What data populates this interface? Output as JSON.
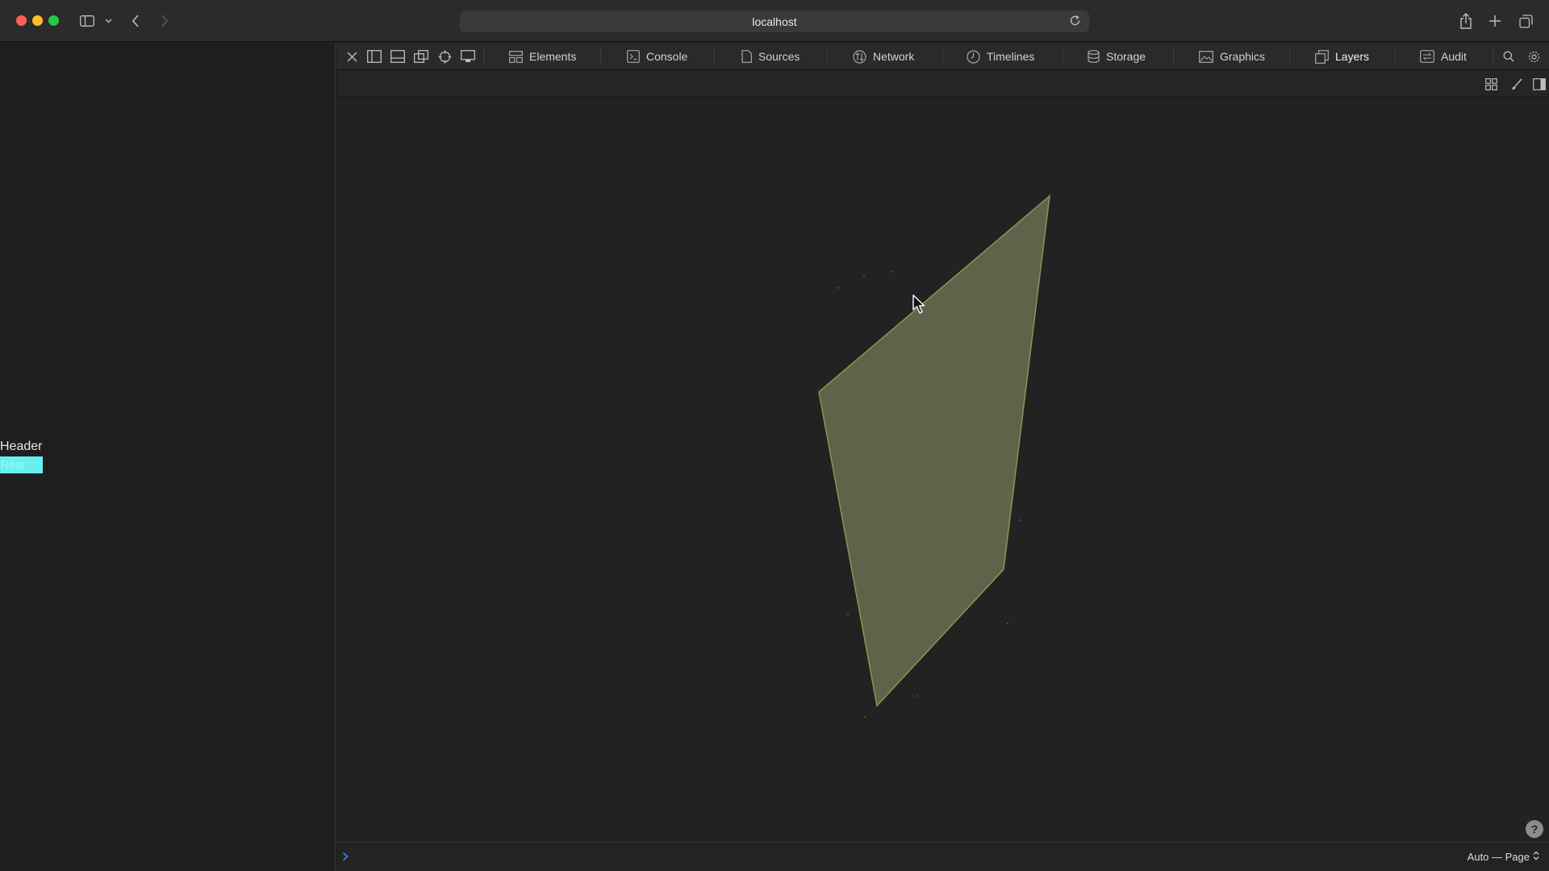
{
  "browser": {
    "url": "localhost"
  },
  "page": {
    "header_text": "Header",
    "rest_text": "Rest"
  },
  "devtools": {
    "tabs": [
      {
        "label": "Elements",
        "icon": "elements-icon"
      },
      {
        "label": "Console",
        "icon": "console-icon"
      },
      {
        "label": "Sources",
        "icon": "sources-icon"
      },
      {
        "label": "Network",
        "icon": "network-icon"
      },
      {
        "label": "Timelines",
        "icon": "timelines-icon"
      },
      {
        "label": "Storage",
        "icon": "storage-icon"
      },
      {
        "label": "Graphics",
        "icon": "graphics-icon"
      },
      {
        "label": "Layers",
        "icon": "layers-icon",
        "active": true
      },
      {
        "label": "Audit",
        "icon": "audit-icon"
      }
    ],
    "help_label": "?",
    "mode_label": "Auto — Page"
  },
  "colors": {
    "layer_fill": "#5f6349",
    "layer_edge": "#8e9450",
    "rest_bg": "#66f0f0",
    "prompt_blue": "#3d7cf0"
  }
}
